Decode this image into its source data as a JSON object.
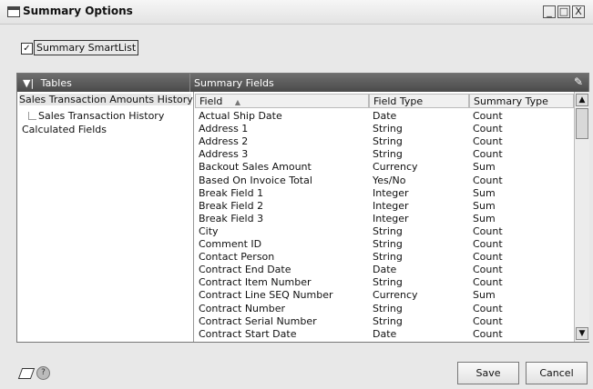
{
  "window": {
    "title": "Summary Options",
    "controls": [
      "_",
      "□",
      "X"
    ]
  },
  "smartlist": {
    "checked": true,
    "label": "Summary SmartList"
  },
  "panel": {
    "tables_header": "Tables",
    "summary_fields_header": "Summary Fields",
    "tables": [
      "Sales Transaction Amounts History",
      "Sales Transaction History",
      "Calculated Fields"
    ],
    "columns": [
      "Field",
      "Field Type",
      "Summary Type"
    ],
    "sort_indicator": "▲",
    "rows": [
      [
        "Actual Ship Date",
        "Date",
        "Count"
      ],
      [
        "Address 1",
        "String",
        "Count"
      ],
      [
        "Address 2",
        "String",
        "Count"
      ],
      [
        "Address 3",
        "String",
        "Count"
      ],
      [
        "Backout Sales Amount",
        "Currency",
        "Sum"
      ],
      [
        "Based On Invoice Total",
        "Yes/No",
        "Count"
      ],
      [
        "Break Field 1",
        "Integer",
        "Sum"
      ],
      [
        "Break Field 2",
        "Integer",
        "Sum"
      ],
      [
        "Break Field 3",
        "Integer",
        "Sum"
      ],
      [
        "City",
        "String",
        "Count"
      ],
      [
        "Comment ID",
        "String",
        "Count"
      ],
      [
        "Contact Person",
        "String",
        "Count"
      ],
      [
        "Contract End Date",
        "Date",
        "Count"
      ],
      [
        "Contract Item Number",
        "String",
        "Count"
      ],
      [
        "Contract Line SEQ Number",
        "Currency",
        "Sum"
      ],
      [
        "Contract Number",
        "String",
        "Count"
      ],
      [
        "Contract Serial Number",
        "String",
        "Count"
      ],
      [
        "Contract Start Date",
        "Date",
        "Count"
      ]
    ]
  },
  "footer": {
    "save_label": "Save",
    "cancel_label": "Cancel"
  }
}
